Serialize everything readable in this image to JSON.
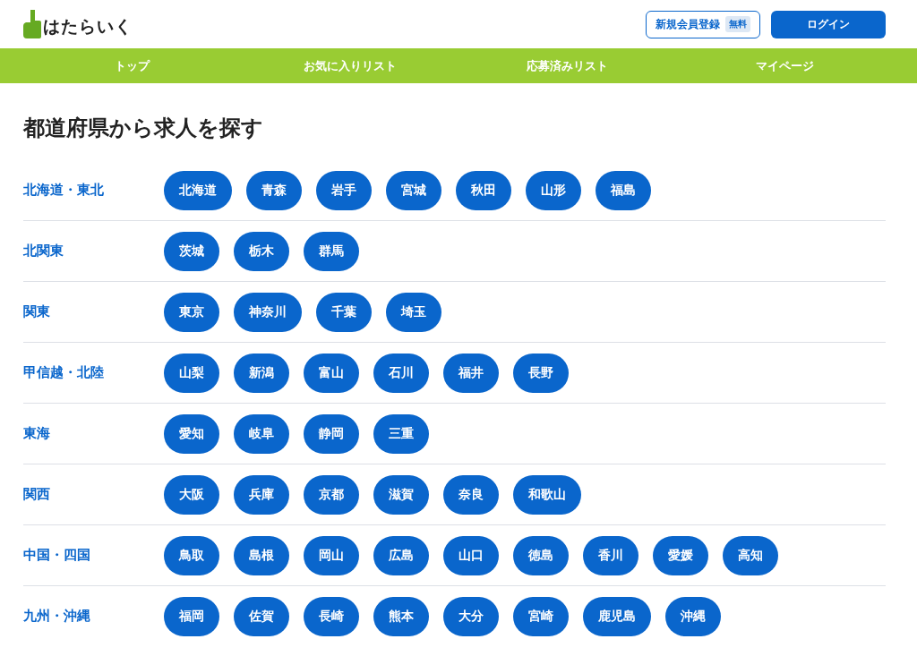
{
  "header": {
    "logo": "はたらいく",
    "register": {
      "label": "新規会員登録",
      "badge": "無料"
    },
    "login": "ログイン"
  },
  "nav": [
    "トップ",
    "お気に入りリスト",
    "応募済みリスト",
    "マイページ"
  ],
  "title": "都道府県から求人を探す",
  "regions": [
    {
      "name": "北海道・東北",
      "prefectures": [
        "北海道",
        "青森",
        "岩手",
        "宮城",
        "秋田",
        "山形",
        "福島"
      ]
    },
    {
      "name": "北関東",
      "prefectures": [
        "茨城",
        "栃木",
        "群馬"
      ]
    },
    {
      "name": "関東",
      "prefectures": [
        "東京",
        "神奈川",
        "千葉",
        "埼玉"
      ]
    },
    {
      "name": "甲信越・北陸",
      "prefectures": [
        "山梨",
        "新潟",
        "富山",
        "石川",
        "福井",
        "長野"
      ]
    },
    {
      "name": "東海",
      "prefectures": [
        "愛知",
        "岐阜",
        "静岡",
        "三重"
      ]
    },
    {
      "name": "関西",
      "prefectures": [
        "大阪",
        "兵庫",
        "京都",
        "滋賀",
        "奈良",
        "和歌山"
      ]
    },
    {
      "name": "中国・四国",
      "prefectures": [
        "鳥取",
        "島根",
        "岡山",
        "広島",
        "山口",
        "徳島",
        "香川",
        "愛媛",
        "高知"
      ]
    },
    {
      "name": "九州・沖縄",
      "prefectures": [
        "福岡",
        "佐賀",
        "長崎",
        "熊本",
        "大分",
        "宮崎",
        "鹿児島",
        "沖縄"
      ]
    }
  ]
}
